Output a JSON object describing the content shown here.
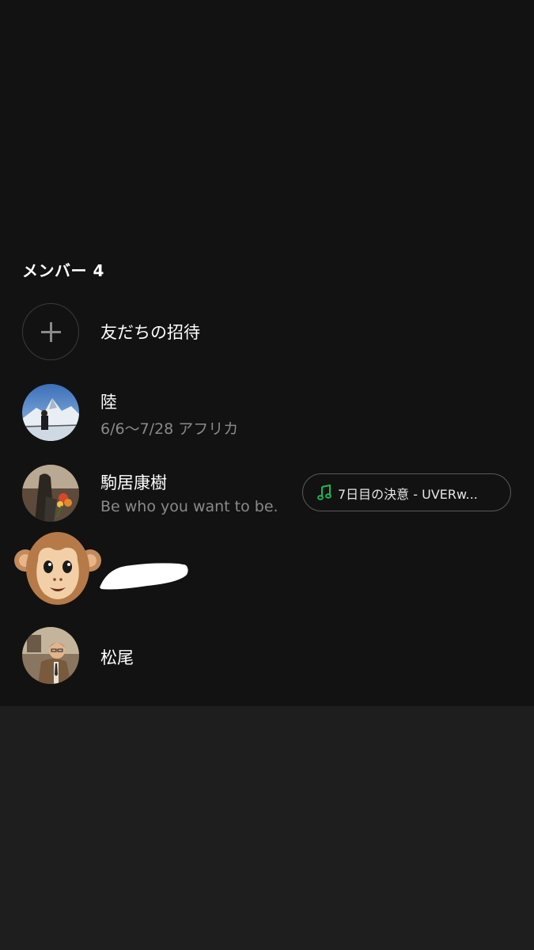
{
  "members_section": {
    "header": "メンバー 4"
  },
  "invite": {
    "label": "友だちの招待",
    "icon": "plus-icon"
  },
  "members": [
    {
      "name": "陸",
      "status": "6/6〜7/28 アフリカ",
      "avatar": "avatar-photo-mountain"
    },
    {
      "name": "駒居康樹",
      "status": "Be who you want to be.",
      "avatar": "avatar-photo-flowers",
      "music": {
        "icon": "music-note-icon",
        "text": "7日目の決意 - UVERw...",
        "icon_color": "#1DB954"
      }
    },
    {
      "name": "",
      "avatar": "monkey-emoji-avatar",
      "name_redacted": true
    },
    {
      "name": "松尾",
      "avatar": "avatar-photo-man"
    }
  ],
  "colors": {
    "background": "#121212",
    "bottom_background": "#1e1e1e",
    "secondary_text": "#8a8a8a",
    "accent_green": "#1DB954"
  }
}
